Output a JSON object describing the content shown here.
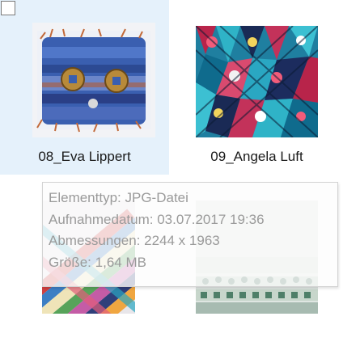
{
  "items": [
    {
      "name": "08_Eva Lippert",
      "selected": true
    },
    {
      "name": "09_Angela Luft",
      "selected": false
    },
    {
      "name": "",
      "selected": false
    },
    {
      "name": "",
      "selected": false
    }
  ],
  "tooltip": {
    "type_label": "Elementtyp:",
    "type_value": "JPG-Datei",
    "date_label": "Aufnahmedatum:",
    "date_value": "03.07.2017 19:36",
    "dims_label": "Abmessungen:",
    "dims_value": "2244 x 1963",
    "size_label": "Größe:",
    "size_value": "1,64 MB"
  },
  "colors": {
    "selection_background": "#e5f1fb",
    "tooltip_text": "#9a9a9a"
  }
}
